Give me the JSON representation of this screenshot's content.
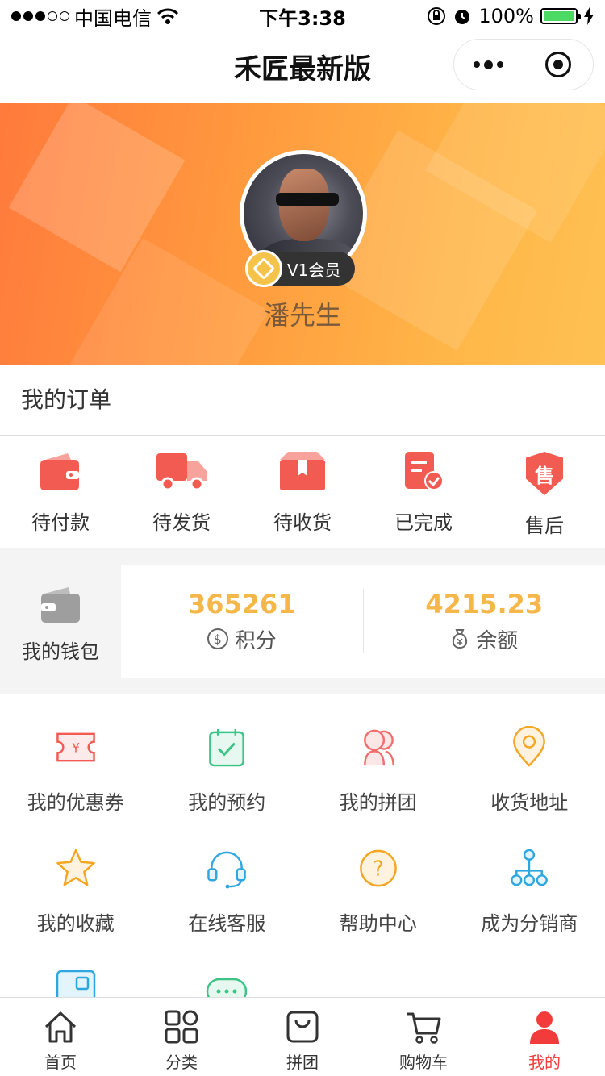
{
  "status_bar": {
    "carrier": "中国电信",
    "time": "下午3:38",
    "battery": "100%"
  },
  "nav": {
    "title": "禾匠最新版"
  },
  "profile": {
    "member_level": "V1会员",
    "username": "潘先生"
  },
  "orders": {
    "title": "我的订单",
    "items": [
      {
        "label": "待付款",
        "icon": "wallet-icon"
      },
      {
        "label": "待发货",
        "icon": "truck-icon"
      },
      {
        "label": "待收货",
        "icon": "package-icon"
      },
      {
        "label": "已完成",
        "icon": "completed-doc-icon"
      },
      {
        "label": "售后",
        "icon": "after-sales-shield-icon",
        "glyph": "售"
      }
    ]
  },
  "wallet": {
    "label": "我的钱包",
    "points_value": "365261",
    "points_label": "积分",
    "balance_value": "4215.23",
    "balance_label": "余额"
  },
  "menu": {
    "items": [
      {
        "label": "我的优惠券",
        "icon": "coupon-icon"
      },
      {
        "label": "我的预约",
        "icon": "appointment-icon"
      },
      {
        "label": "我的拼团",
        "icon": "group-buy-icon"
      },
      {
        "label": "收货地址",
        "icon": "location-pin-icon"
      },
      {
        "label": "我的收藏",
        "icon": "star-icon"
      },
      {
        "label": "在线客服",
        "icon": "headset-icon"
      },
      {
        "label": "帮助中心",
        "icon": "help-icon"
      },
      {
        "label": "成为分销商",
        "icon": "distributor-icon"
      }
    ]
  },
  "tabs": [
    {
      "label": "首页",
      "icon": "home-icon"
    },
    {
      "label": "分类",
      "icon": "category-icon"
    },
    {
      "label": "拼团",
      "icon": "group-bag-icon"
    },
    {
      "label": "购物车",
      "icon": "cart-icon"
    },
    {
      "label": "我的",
      "icon": "user-icon"
    }
  ],
  "colors": {
    "accent": "#f23c3c",
    "wallet_value": "#f6b74a",
    "banner_from": "#ff7a3c",
    "banner_to": "#ffc153"
  }
}
